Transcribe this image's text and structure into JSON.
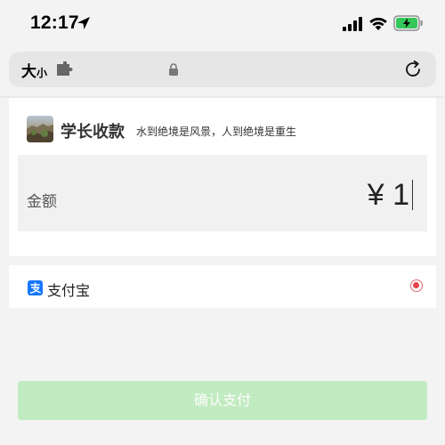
{
  "status_bar": {
    "time": "12:17",
    "icons": [
      "location-arrow-icon",
      "cellular-signal-icon",
      "wifi-icon",
      "battery-charging-icon"
    ]
  },
  "url_bar": {
    "text_size_big": "大",
    "text_size_small": "小",
    "icons": [
      "extension-icon",
      "lock-icon",
      "reload-icon"
    ]
  },
  "merchant": {
    "name": "学长收款",
    "motto": "水到绝境是风景，人到绝境是重生"
  },
  "amount": {
    "label": "金额",
    "value": "¥ 1"
  },
  "payment_method": {
    "label": "支付宝",
    "selected": true,
    "icon": "alipay-icon"
  },
  "confirm_button": {
    "label": "确认支付"
  },
  "colors": {
    "confirm_bg": "#c1ebc0",
    "radio_selected": "#e8424d",
    "alipay_blue": "#1677ff",
    "battery_green": "#34c759"
  }
}
